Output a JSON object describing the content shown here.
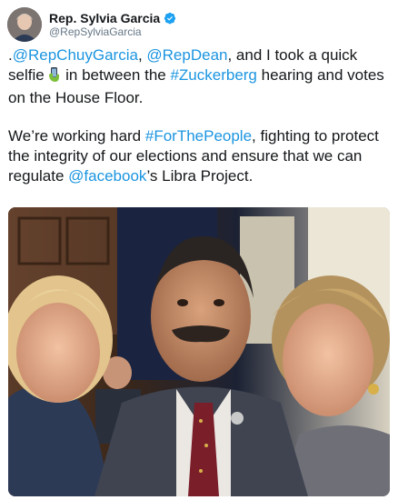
{
  "user": {
    "display_name": "Rep. Sylvia Garcia",
    "handle": "@RepSylviaGarcia",
    "verified_icon": "verified-badge-icon"
  },
  "tweet": {
    "p1": {
      "lead": ".",
      "mention1": "@RepChuyGarcia",
      "sep1": ", ",
      "mention2": "@RepDean",
      "text1": ", and I took a quick selfie ",
      "emoji": "selfie-hand-icon",
      "text2": " in between the ",
      "hashtag": "#Zuckerberg",
      "text3": " hearing and votes on the House Floor."
    },
    "p2": {
      "text1": "We’re working hard ",
      "hashtag": "#ForThePeople",
      "text2": ", fighting to protect the integrity of our elections and ensure that we can regulate ",
      "mention": "@facebook",
      "text3": "’s Libra Project."
    }
  },
  "colors": {
    "link": "#1b95e0",
    "text": "#14171a",
    "secondary": "#657786"
  }
}
